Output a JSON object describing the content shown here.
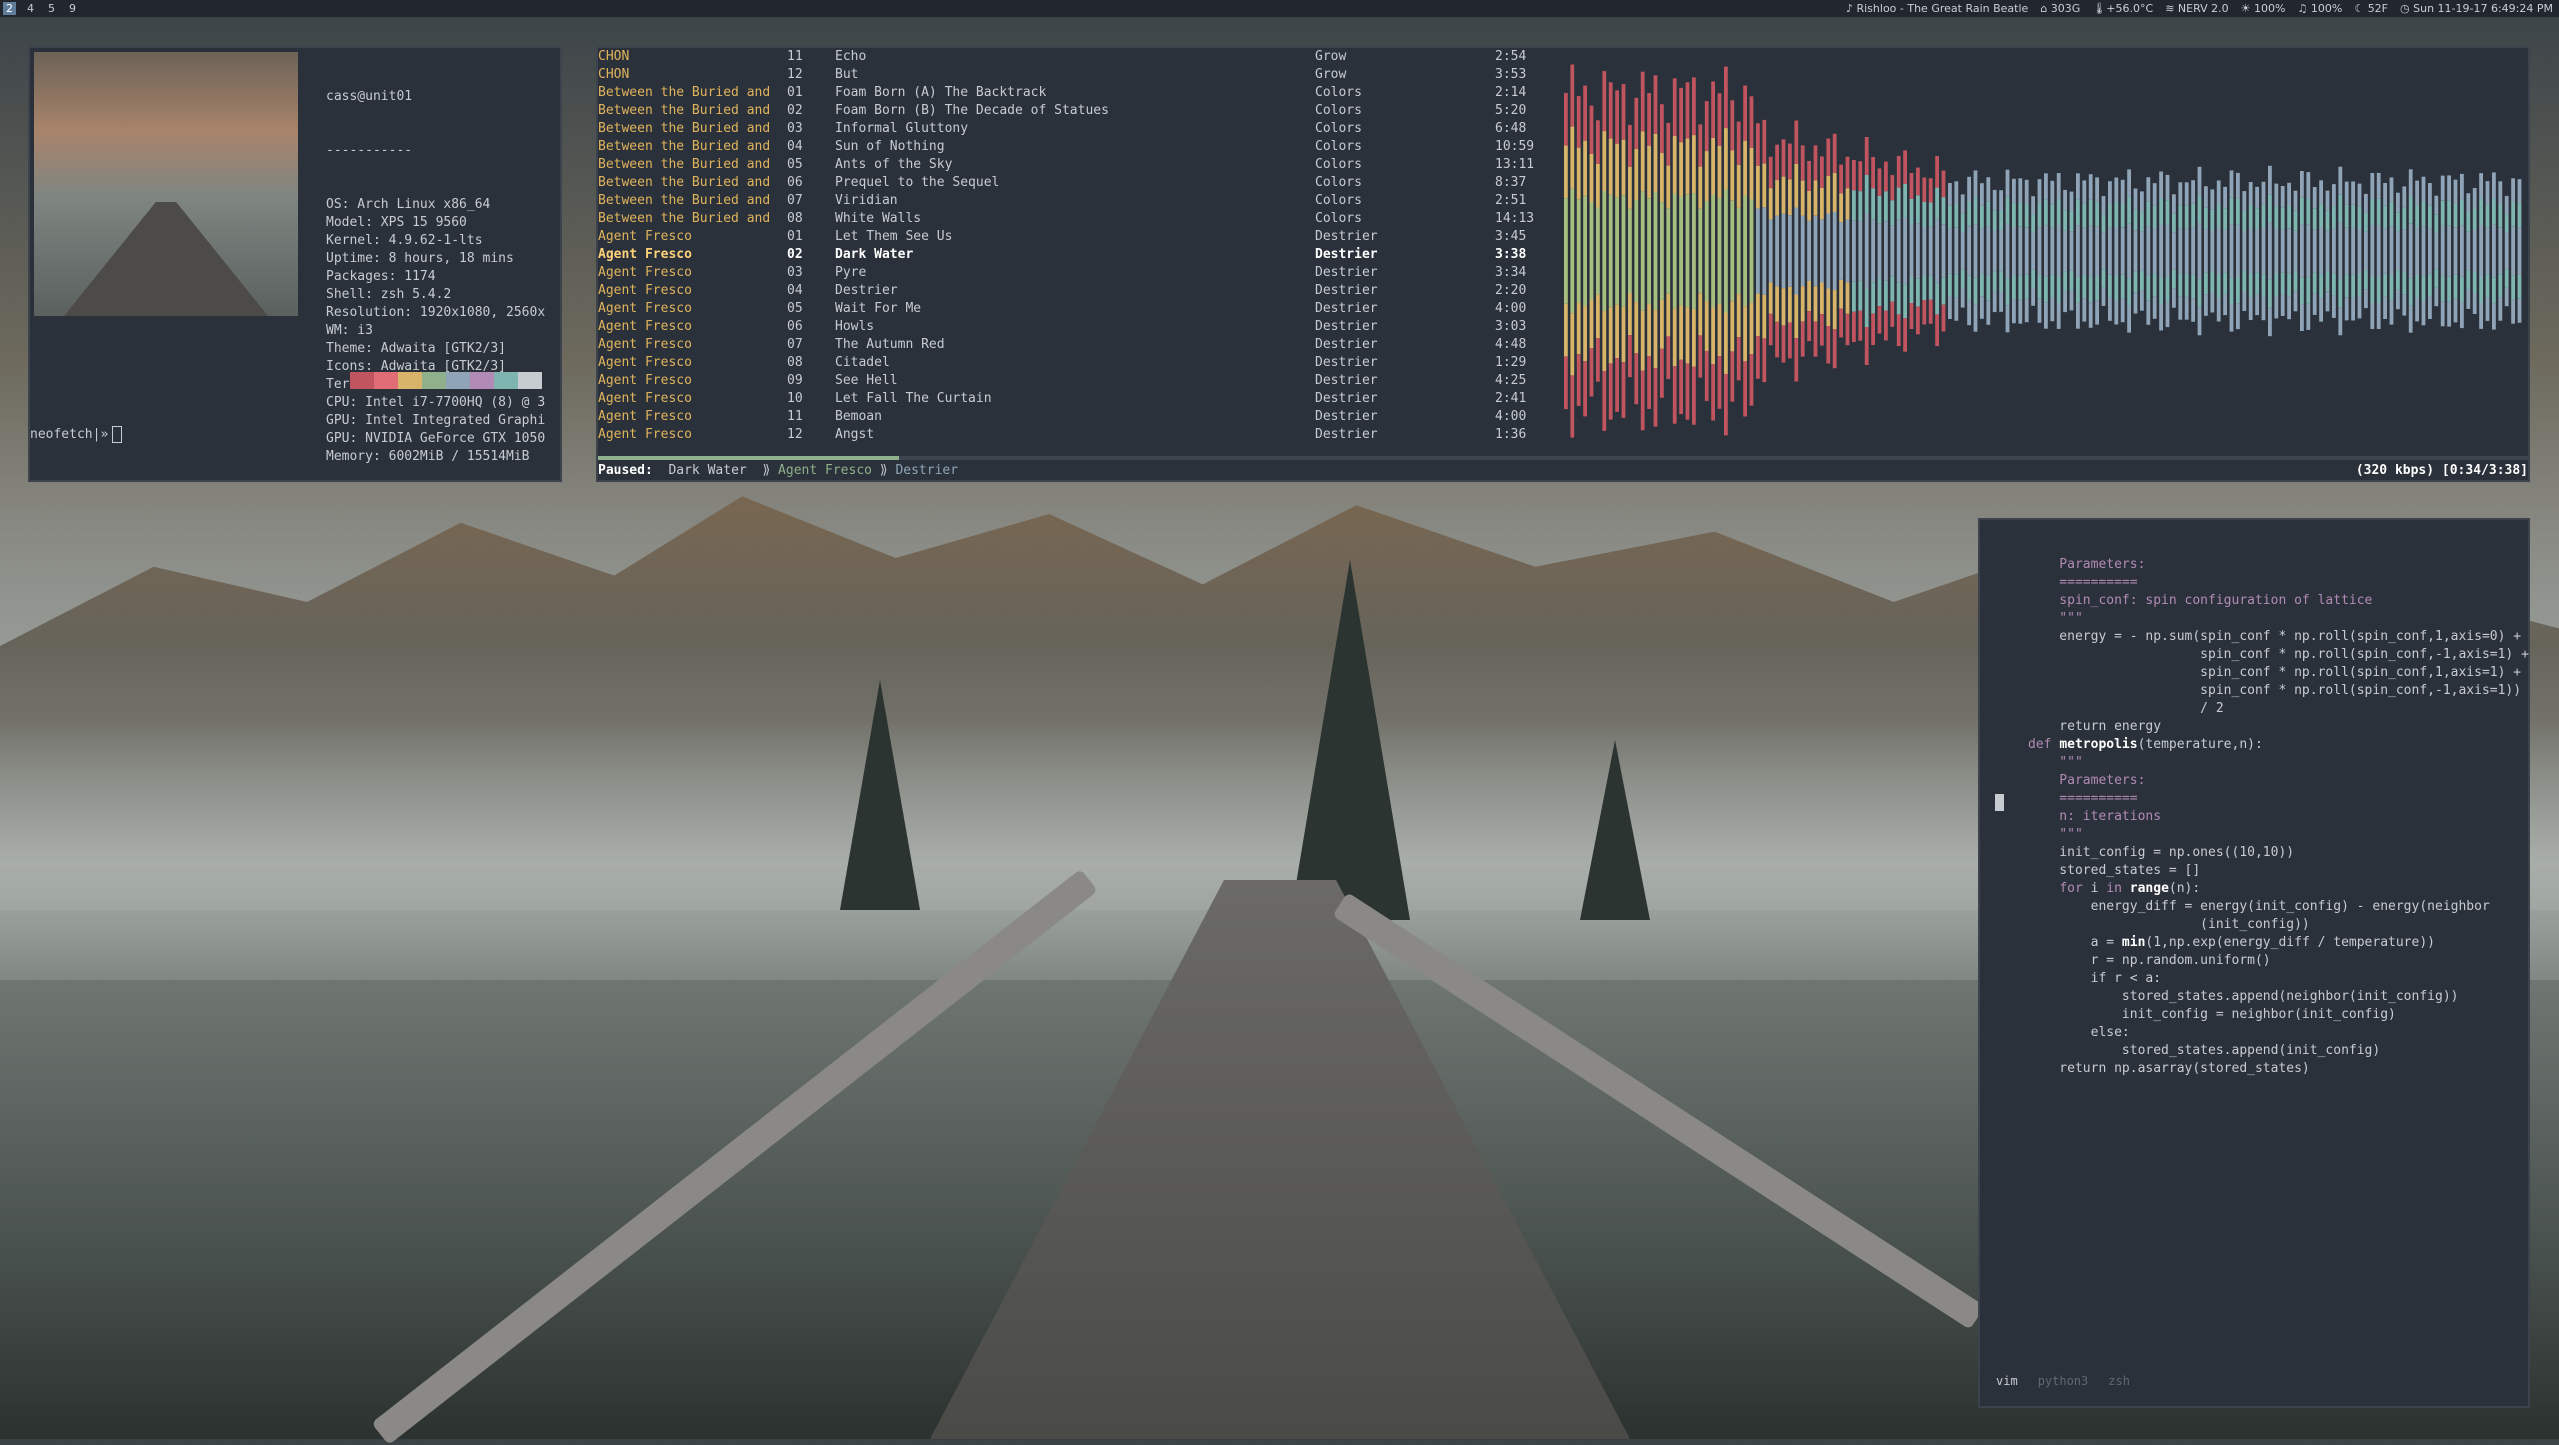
{
  "topbar": {
    "workspaces": [
      "2",
      "4",
      "5",
      "9"
    ],
    "active_workspace": "2",
    "now_playing": "♪ Rishloo - The Great Rain Beatle",
    "disk": "303G",
    "temp": "+56.0°C",
    "wifi": "NERV 2.0",
    "brightness": "100%",
    "volume": "100%",
    "weather": "52F",
    "datetime": "Sun 11-19-17  6:49:24 PM"
  },
  "neofetch": {
    "user_host": "cass@unit01",
    "separator": "-----------",
    "info": [
      "OS: Arch Linux x86_64",
      "Model: XPS 15 9560",
      "Kernel: 4.9.62-1-lts",
      "Uptime: 8 hours, 18 mins",
      "Packages: 1174",
      "Shell: zsh 5.4.2",
      "Resolution: 1920x1080, 2560x",
      "WM: i3",
      "Theme: Adwaita [GTK2/3]",
      "Icons: Adwaita [GTK2/3]",
      "Terminal: urxvt",
      "CPU: Intel i7-7700HQ (8) @ 3",
      "GPU: Intel Integrated Graphi",
      "GPU: NVIDIA GeForce GTX 1050",
      "Memory: 6002MiB / 15514MiB"
    ],
    "colors": [
      "#c0545f",
      "#e06c75",
      "#d8b36a",
      "#8fb08a",
      "#8fa4b6",
      "#b18bb5",
      "#7fb5b0",
      "#c7ccd1"
    ],
    "prompt": "neofetch|»"
  },
  "player": {
    "playlist": [
      {
        "artist": "CHON",
        "track": "11",
        "title": "Echo",
        "album": "Grow",
        "time": "2:54"
      },
      {
        "artist": "CHON",
        "track": "12",
        "title": "But",
        "album": "Grow",
        "time": "3:53"
      },
      {
        "artist": "Between the Buried and",
        "track": "01",
        "title": "Foam Born (A) The Backtrack",
        "album": "Colors",
        "time": "2:14"
      },
      {
        "artist": "Between the Buried and",
        "track": "02",
        "title": "Foam Born (B) The Decade of Statues",
        "album": "Colors",
        "time": "5:20"
      },
      {
        "artist": "Between the Buried and",
        "track": "03",
        "title": "Informal Gluttony",
        "album": "Colors",
        "time": "6:48"
      },
      {
        "artist": "Between the Buried and",
        "track": "04",
        "title": "Sun of Nothing",
        "album": "Colors",
        "time": "10:59"
      },
      {
        "artist": "Between the Buried and",
        "track": "05",
        "title": "Ants of the Sky",
        "album": "Colors",
        "time": "13:11"
      },
      {
        "artist": "Between the Buried and",
        "track": "06",
        "title": "Prequel to the Sequel",
        "album": "Colors",
        "time": "8:37"
      },
      {
        "artist": "Between the Buried and",
        "track": "07",
        "title": "Viridian",
        "album": "Colors",
        "time": "2:51"
      },
      {
        "artist": "Between the Buried and",
        "track": "08",
        "title": "White Walls",
        "album": "Colors",
        "time": "14:13"
      },
      {
        "artist": "Agent Fresco",
        "track": "01",
        "title": "Let Them See Us",
        "album": "Destrier",
        "time": "3:45"
      },
      {
        "artist": "Agent Fresco",
        "track": "02",
        "title": "Dark Water",
        "album": "Destrier",
        "time": "3:38",
        "current": true
      },
      {
        "artist": "Agent Fresco",
        "track": "03",
        "title": "Pyre",
        "album": "Destrier",
        "time": "3:34"
      },
      {
        "artist": "Agent Fresco",
        "track": "04",
        "title": "Destrier",
        "album": "Destrier",
        "time": "2:20"
      },
      {
        "artist": "Agent Fresco",
        "track": "05",
        "title": "Wait For Me",
        "album": "Destrier",
        "time": "4:00"
      },
      {
        "artist": "Agent Fresco",
        "track": "06",
        "title": "Howls",
        "album": "Destrier",
        "time": "3:03"
      },
      {
        "artist": "Agent Fresco",
        "track": "07",
        "title": "The Autumn Red",
        "album": "Destrier",
        "time": "4:48"
      },
      {
        "artist": "Agent Fresco",
        "track": "08",
        "title": "Citadel",
        "album": "Destrier",
        "time": "1:29"
      },
      {
        "artist": "Agent Fresco",
        "track": "09",
        "title": "See Hell",
        "album": "Destrier",
        "time": "4:25"
      },
      {
        "artist": "Agent Fresco",
        "track": "10",
        "title": "Let Fall The Curtain",
        "album": "Destrier",
        "time": "2:41"
      },
      {
        "artist": "Agent Fresco",
        "track": "11",
        "title": "Bemoan",
        "album": "Destrier",
        "time": "4:00"
      },
      {
        "artist": "Agent Fresco",
        "track": "12",
        "title": "Angst",
        "album": "Destrier",
        "time": "1:36"
      }
    ],
    "status_label": "Paused:",
    "status_title": "Dark Water",
    "status_artist": "Agent Fresco",
    "status_album": "Destrier",
    "sep": "⟫",
    "bitrate_time": "(320 kbps) [0:34/3:38]",
    "progress_fraction": 0.156,
    "visualizer_colors": [
      "#c0545f",
      "#b18bb5",
      "#d8b36a",
      "#a6bf80",
      "#8fb08a",
      "#7fb5b0",
      "#8fa4b6"
    ]
  },
  "vim": {
    "lines": [
      [
        "cm",
        "    Parameters:"
      ],
      [
        "cm",
        "    =========="
      ],
      [
        "cm",
        "    spin_conf: spin configuration of lattice"
      ],
      [
        "cm",
        "    \"\"\""
      ],
      [
        "",
        ""
      ],
      [
        "",
        "    energy = - np.sum(spin_conf * np.roll(spin_conf,1,axis=0) +"
      ],
      [
        "",
        "                      spin_conf * np.roll(spin_conf,-1,axis=1) +"
      ],
      [
        "",
        ""
      ],
      [
        "",
        "                      spin_conf * np.roll(spin_conf,1,axis=1) +"
      ],
      [
        "",
        "                      spin_conf * np.roll(spin_conf,-1,axis=1))"
      ],
      [
        "",
        "                      / 2"
      ],
      [
        "",
        "    return energy"
      ],
      [
        "",
        ""
      ],
      [
        "def",
        "def metropolis(temperature,n):"
      ],
      [
        "cm",
        "    \"\"\""
      ],
      [
        "cm",
        "    Parameters:"
      ],
      [
        "cm",
        "    =========="
      ],
      [
        "cm",
        "    n: iterations"
      ],
      [
        "cm",
        "    \"\"\""
      ],
      [
        "",
        ""
      ],
      [
        "",
        "    init_config = np.ones((10,10))"
      ],
      [
        "",
        "    stored_states = []"
      ],
      [
        "",
        ""
      ],
      [
        "for",
        "    for i in range(n):"
      ],
      [
        "",
        ""
      ],
      [
        "",
        "        energy_diff = energy(init_config) - energy(neighbor"
      ],
      [
        "",
        "                      (init_config))"
      ],
      [
        "",
        ""
      ],
      [
        "min",
        "        a = min(1,np.exp(energy_diff / temperature))"
      ],
      [
        "",
        ""
      ],
      [
        "",
        "        r = np.random.uniform()"
      ],
      [
        "",
        ""
      ],
      [
        "",
        "        if r < a:"
      ],
      [
        "",
        ""
      ],
      [
        "",
        "            stored_states.append(neighbor(init_config))"
      ],
      [
        "",
        "            init_config = neighbor(init_config)"
      ],
      [
        "",
        ""
      ],
      [
        "",
        "        else:"
      ],
      [
        "",
        ""
      ],
      [
        "",
        "            stored_states.append(init_config)"
      ],
      [
        "",
        ""
      ],
      [
        "",
        "    return np.asarray(stored_states)"
      ]
    ],
    "tabs": [
      "vim",
      "python3",
      "zsh"
    ]
  }
}
